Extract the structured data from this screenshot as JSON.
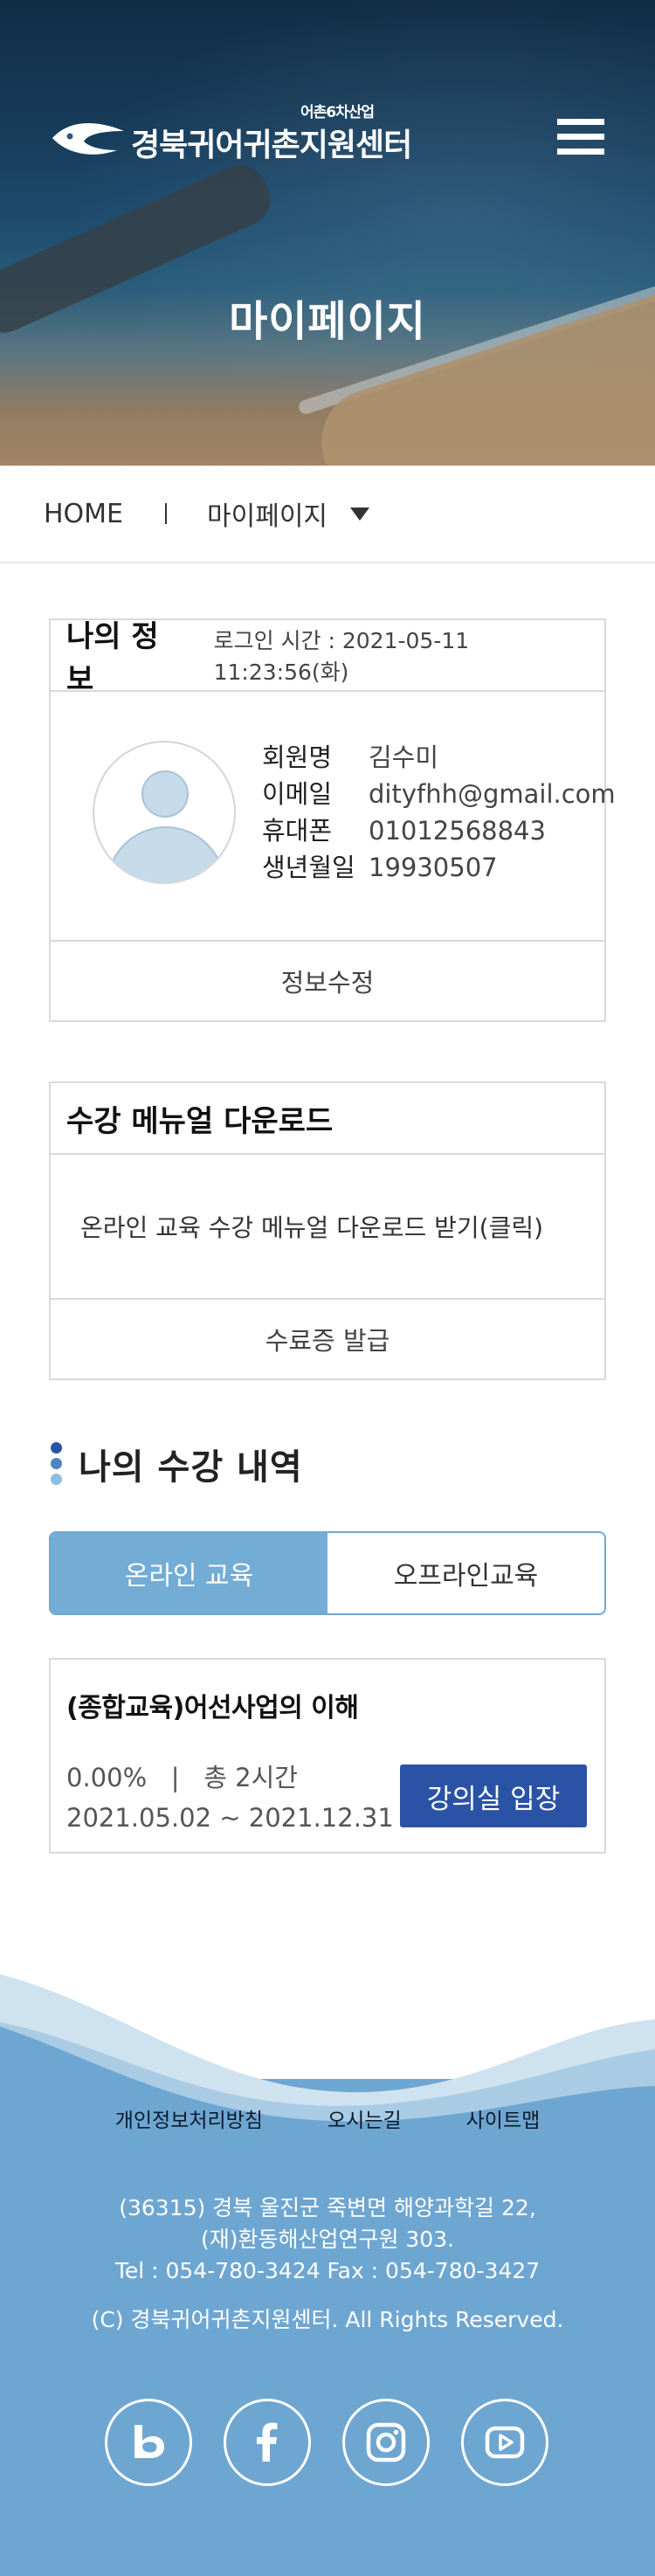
{
  "header": {
    "logo_text": "경북귀어귀촌지원센터",
    "logo_tagline": "어촌6차산업",
    "page_title": "마이페이지",
    "menu_icon": "hamburger-menu-icon"
  },
  "breadcrumb": {
    "home": "HOME",
    "current": "마이페이지",
    "caret_icon": "caret-down-icon"
  },
  "my_info": {
    "title": "나의 정보",
    "login_time": "로그인 시간 : 2021-05-11 11:23:56(화)",
    "fields": [
      {
        "label": "회원명",
        "value": "김수미"
      },
      {
        "label": "이메일",
        "value": "dityfhh@gmail.com"
      },
      {
        "label": "휴대폰",
        "value": "01012568843"
      },
      {
        "label": "생년월일",
        "value": "19930507"
      }
    ],
    "edit_button": "정보수정"
  },
  "manual": {
    "title": "수강 메뉴얼 다운로드",
    "link_text": "온라인 교육 수강 메뉴얼 다운로드 받기(클릭)",
    "certificate_button": "수료증 발급"
  },
  "history": {
    "title": "나의 수강 내역",
    "tabs": [
      {
        "label": "온라인 교육",
        "active": true
      },
      {
        "label": "오프라인교육",
        "active": false
      }
    ],
    "courses": [
      {
        "name": "(종합교육)어선사업의 이해",
        "progress": "0.00%",
        "total": "총 2시간",
        "period": "2021.05.02 ~ 2021.12.31",
        "enter_button": "강의실 입장"
      }
    ]
  },
  "footer": {
    "links": [
      "개인정보처리방침",
      "오시는길",
      "사이트맵"
    ],
    "address_line1": "(36315) 경북 울진군 죽변면 해양과학길 22,",
    "address_line2": "(재)환동해산업연구원 303.",
    "contact": "Tel : 054-780-3424    Fax : 054-780-3427",
    "copyright": "(C) 경북귀어귀촌지원센터. All Rights Reserved.",
    "social_icons": [
      "blog-icon",
      "facebook-icon",
      "instagram-icon",
      "youtube-icon"
    ]
  },
  "colors": {
    "accent_blue": "#73acd5",
    "button_navy": "#2a53a6",
    "footer_blue": "#6ea6d2"
  }
}
